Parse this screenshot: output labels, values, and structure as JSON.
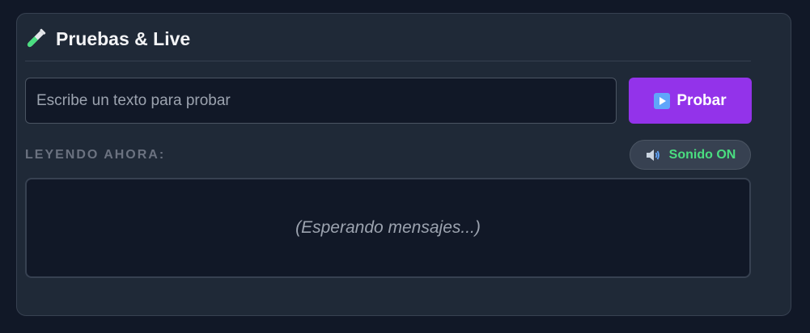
{
  "panel": {
    "title": "Pruebas & Live",
    "title_icon": "test-tube-icon"
  },
  "test_input": {
    "value": "",
    "placeholder": "Escribe un texto para probar"
  },
  "test_button": {
    "label": "Probar",
    "icon": "play-icon",
    "color": "#9333ea"
  },
  "reading_now": {
    "label": "LEYENDO AHORA:"
  },
  "sound_toggle": {
    "label": "Sonido ON",
    "icon": "speaker-icon",
    "color": "#4ade80"
  },
  "display": {
    "message": "(Esperando mensajes...)"
  }
}
